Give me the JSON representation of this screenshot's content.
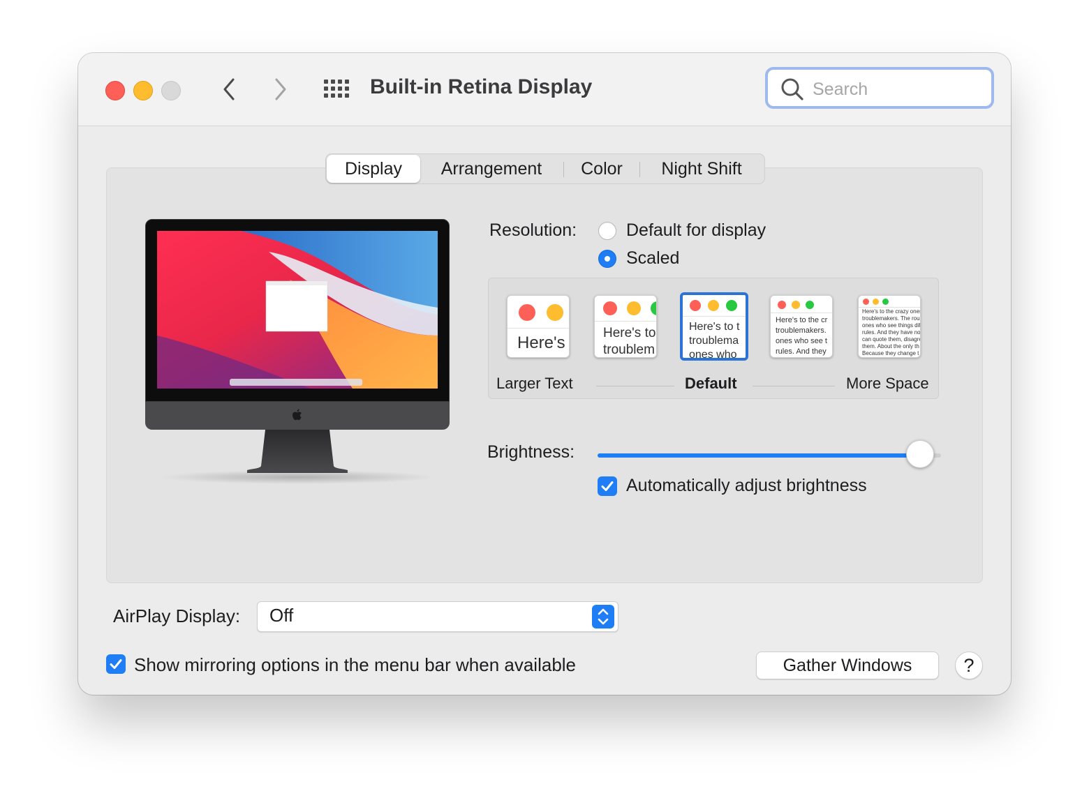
{
  "window": {
    "title": "Built-in Retina Display",
    "search_placeholder": "Search"
  },
  "tabs": [
    {
      "label": "Display",
      "active": true
    },
    {
      "label": "Arrangement",
      "active": false
    },
    {
      "label": "Color",
      "active": false
    },
    {
      "label": "Night Shift",
      "active": false
    }
  ],
  "resolution": {
    "label": "Resolution:",
    "options": [
      {
        "label": "Default for display",
        "selected": false
      },
      {
        "label": "Scaled",
        "selected": true
      }
    ],
    "scaled_labels": {
      "left": "Larger Text",
      "middle": "Default",
      "right": "More Space"
    },
    "thumbnails": [
      {
        "text": "Here's",
        "selected": false
      },
      {
        "text": "Here's to\ntroublem",
        "selected": false
      },
      {
        "text": "Here's to t\ntroublema\nones who",
        "selected": true
      },
      {
        "text": "Here's to the cr\ntroublemakers.\nones who see t\nrules. And they",
        "selected": false
      },
      {
        "text": "Here's to the crazy ones\ntroublemakers. The rou\nones who see things dif\nrules. And they have no\ncan quote them, disagre\nthem. About the only th\nBecause they change t",
        "selected": false
      }
    ]
  },
  "brightness": {
    "label": "Brightness:",
    "level": 0.94,
    "auto_label": "Automatically adjust brightness",
    "auto_checked": true
  },
  "airplay": {
    "label": "AirPlay Display:",
    "value": "Off"
  },
  "mirroring": {
    "label": "Show mirroring options in the menu bar when available",
    "checked": true
  },
  "buttons": {
    "gather": "Gather Windows",
    "help": "?"
  },
  "colors": {
    "accent": "#1f7ef5",
    "close": "#fe5f57",
    "minimize": "#febc2e",
    "zoom_disabled": "#d9d9d9"
  },
  "icons": [
    "back-chevron-icon",
    "forward-chevron-icon",
    "show-all-grid-icon",
    "search-icon",
    "apple-logo-icon",
    "checkmark-icon",
    "up-down-arrows-icon"
  ]
}
